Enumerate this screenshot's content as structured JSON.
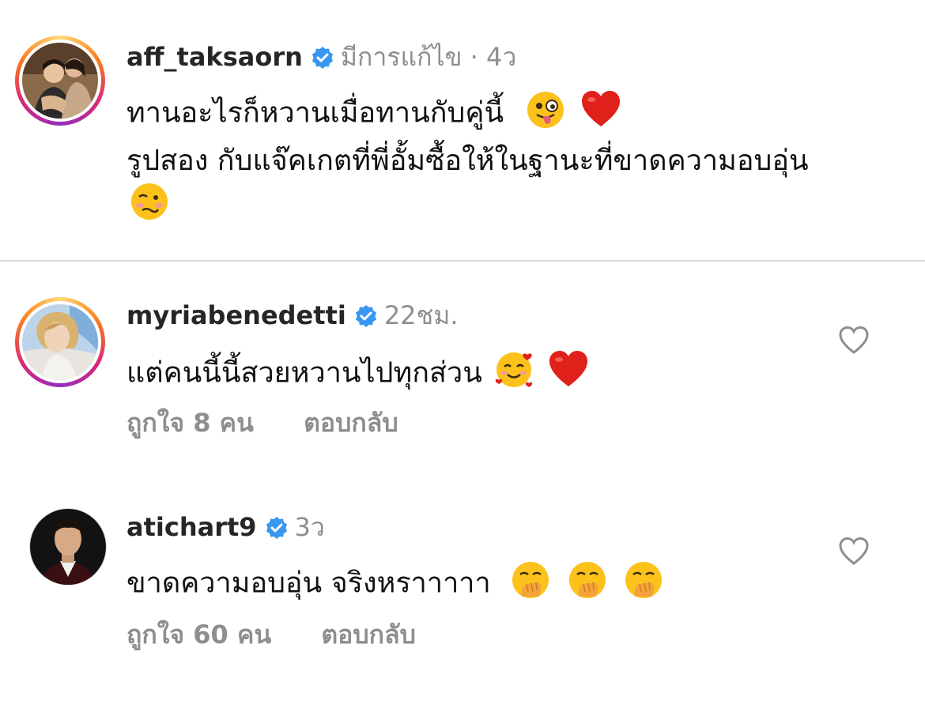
{
  "comments": [
    {
      "username": "aff_taksaorn",
      "meta": "มีการแก้ไข · 4ว",
      "lines": [
        "ทานอะไรก็หวานเมื่อทานกับคู่นี้",
        "รูปสอง กับแจ๊คเกตที่พี่อั้มซื้อให้ในฐานะที่ขาดความอบอุ่น"
      ],
      "emojis": [
        "winking-tongue-face",
        "red-heart",
        "woozy-face"
      ]
    },
    {
      "username": "myriabenedetti",
      "meta": "22ชม.",
      "lines": [
        "แต่คนนี้นี้สวยหวานไปทุกส่วน"
      ],
      "emojis": [
        "smiling-face-with-hearts",
        "red-heart"
      ],
      "likes": "ถูกใจ 8 คน",
      "reply": "ตอบกลับ"
    },
    {
      "username": "atichart9",
      "meta": "3ว",
      "lines": [
        "ขาดความอบอุ่น จริงหราาาาา"
      ],
      "emojis": [
        "face-with-hand-over-mouth",
        "face-with-hand-over-mouth",
        "face-with-hand-over-mouth"
      ],
      "likes": "ถูกใจ 60 คน",
      "reply": "ตอบกลับ"
    }
  ],
  "colors": {
    "verified": "#3897f0",
    "meta_gray": "#8e8e8e",
    "heart_red": "#e0201b",
    "divider": "#dbdbdb"
  }
}
